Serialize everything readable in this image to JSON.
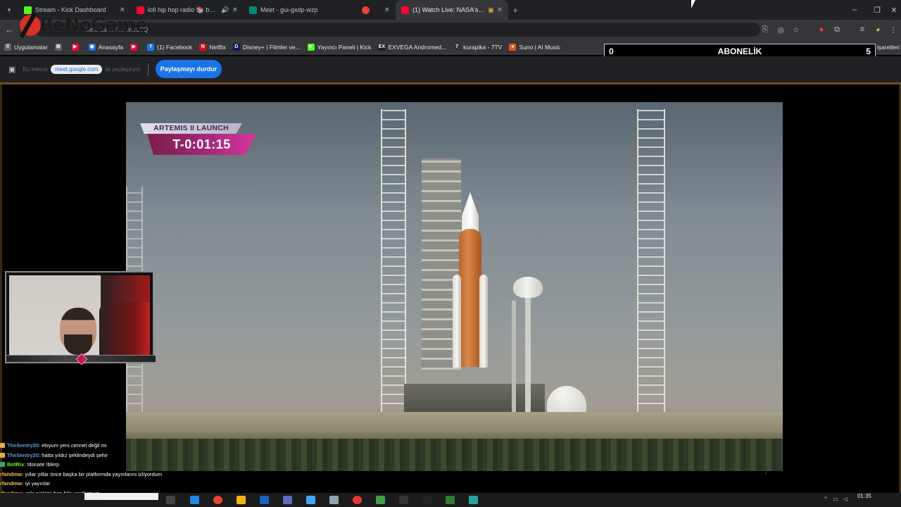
{
  "tabs": [
    {
      "label": "Stream - Kick Dashboard",
      "favicon": "#53fc18",
      "icon": "kick-icon"
    },
    {
      "label": "lofi hip hop radio 📚 beats",
      "favicon": "#ff0033",
      "icon": "youtube-icon",
      "extra": "🔊"
    },
    {
      "label": "Meet - gui-gxdp-wzp",
      "favicon": "#00897b",
      "icon": "google-meet-icon"
    },
    {
      "label": "",
      "favicon": "#ea4335",
      "icon": "recording-icon"
    },
    {
      "label": "(1) Watch Live: NASA's Arte",
      "favicon": "#ff0033",
      "icon": "youtube-icon",
      "extra": "▣",
      "active": true
    }
  ],
  "omnibox": {
    "text": "be.com/watch?v=SwtcS6Q",
    "display": "be.c ea ... / ... wtcS6Q"
  },
  "logo": {
    "brand": "BeNoGame"
  },
  "bookmarks": [
    {
      "label": "Uygulamalar",
      "color": "#5f6368",
      "glyph": "⠿"
    },
    {
      "label": "",
      "color": "#5f6368",
      "glyph": "⊞"
    },
    {
      "label": "",
      "color": "#ff0033",
      "glyph": "▶"
    },
    {
      "label": "Anasayfa",
      "color": "#1a73e8",
      "glyph": "◉"
    },
    {
      "label": "",
      "color": "#ff0033",
      "glyph": "▶"
    },
    {
      "label": "(1) Facebook",
      "color": "#1877f2",
      "glyph": "f"
    },
    {
      "label": "Netflix",
      "color": "#e50914",
      "glyph": "N"
    },
    {
      "label": "Disney+ | Filmler ve...",
      "color": "#0b1a5c",
      "glyph": "D"
    },
    {
      "label": "Yayıncı Paneli | Kick",
      "color": "#53fc18",
      "glyph": "K"
    },
    {
      "label": "EXVEGA Andromed...",
      "color": "#222",
      "glyph": "EX"
    },
    {
      "label": "kurapika - 7TV",
      "color": "#333",
      "glyph": "7"
    },
    {
      "label": "Suno | AI Music",
      "color": "#f4511e",
      "glyph": "●"
    }
  ],
  "all_bookmarks": "Tüm yer işaretleri",
  "subscription": {
    "left": "0",
    "title": "ABONELİK",
    "right": "5"
  },
  "share_bar": {
    "left_text": "Bu sekme",
    "domain": "meet.google.com",
    "right_text": "ile paylaşılıyor",
    "stop_label": "Paylaşmayı durdur"
  },
  "video": {
    "lower_third_top": "ARTEMIS II LAUNCH",
    "countdown": "T-0:01:15"
  },
  "chat": [
    {
      "user": "TheSentry20",
      "msg": ": elsyum yeni cennet değil mi",
      "color": "#5b9bd5",
      "badge": "#e0b14a"
    },
    {
      "user": "TheSentry20",
      "msg": ": hatta yıldız şeklindeydi şehir",
      "color": "#5b9bd5",
      "badge": "#e0b14a"
    },
    {
      "user": "BotRix",
      "msg": ": !donate !blerp",
      "color": "#53fc18",
      "badge": "#3ba55c"
    },
    {
      "user": "rfandmw",
      "msg": ": yıllar yıllar önce başka bir platformda yayınlarını izliyordum",
      "color": "#f0c040",
      "badge": ""
    },
    {
      "user": "rfandmw",
      "msg": ": iyi yayınlar",
      "color": "#f0c040",
      "badge": ""
    },
    {
      "user": "rfandmw",
      "msg": ": eski nickimi ben bile unuttum ya",
      "color": "#f0c040",
      "badge": ""
    }
  ],
  "clock": {
    "time": "01:35"
  }
}
